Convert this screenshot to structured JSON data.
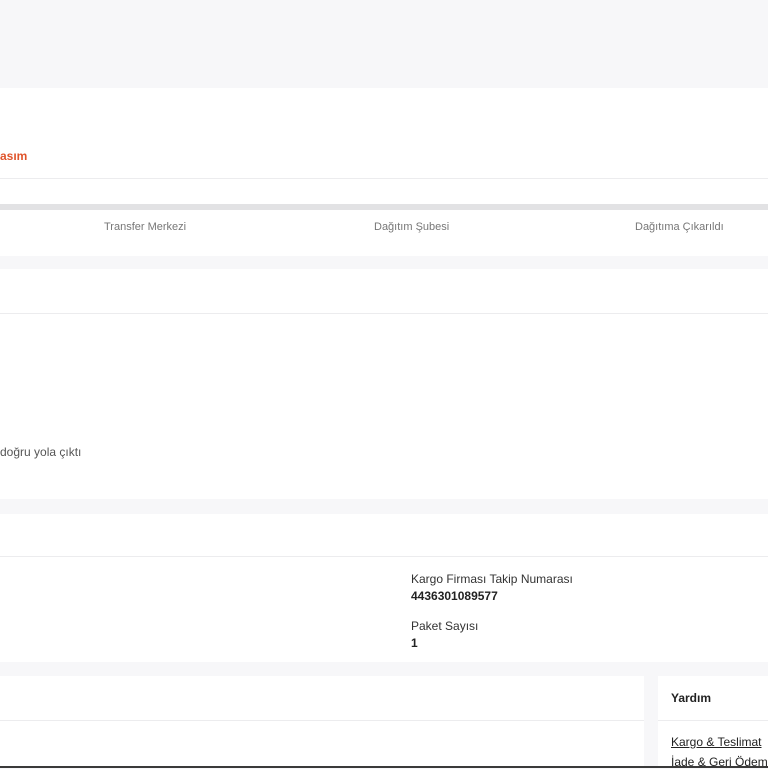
{
  "tracker": {
    "date_text": "asım",
    "steps": [
      "Transfer Merkezi",
      "Dağıtım Şubesi",
      "Dağıtıma Çıkarıldı"
    ]
  },
  "movement": {
    "description": "doğru yola çıktı"
  },
  "shipment": {
    "tracking_label": "Kargo Firması Takip Numarası",
    "tracking_number": "4436301089577",
    "package_label": "Paket Sayısı",
    "package_count": "1"
  },
  "help": {
    "title": "Yardım",
    "links": [
      "Kargo & Teslimat",
      "İade & Geri Ödeme"
    ]
  },
  "colors": {
    "accent": "#e0542b",
    "background": "#f7f7f9",
    "card": "#ffffff"
  }
}
